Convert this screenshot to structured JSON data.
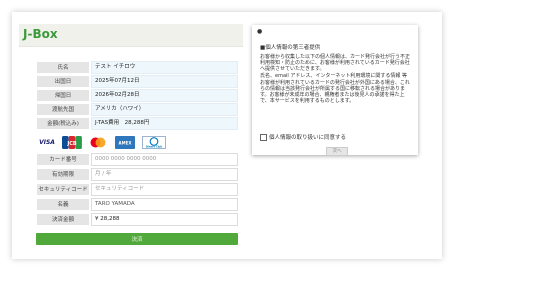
{
  "header": {
    "logo": "J-Box"
  },
  "form": {
    "rows": [
      {
        "label": "氏名",
        "value": "テスト イチロウ"
      },
      {
        "label": "出国日",
        "value": "2025年07月12日"
      },
      {
        "label": "帰国日",
        "value": "2026年02月28日"
      },
      {
        "label": "渡航先国",
        "value": "アメリカ（ハワイ）"
      },
      {
        "label": "金額(税込み)",
        "value": "J-TAS費用　28,288円"
      }
    ],
    "card_brands": [
      "VISA",
      "JCB",
      "MasterCard",
      "AMEX",
      "Diners Club"
    ],
    "card_number": {
      "label": "カード番号",
      "placeholder": "0000 0000 0000 0000"
    },
    "expiry": {
      "label": "有効期限",
      "placeholder": "月 / 年"
    },
    "security": {
      "label": "セキュリティコード",
      "placeholder": "セキュリティコード"
    },
    "name": {
      "label": "名義",
      "value": "TARO YAMADA"
    },
    "amount": {
      "label": "決済金額",
      "value": "¥ 28,288"
    },
    "submit_label": "決済"
  },
  "notice": {
    "mark": "●",
    "title": "■個人情報の第三者提供",
    "paragraphs": [
      "お客様から収集した以下の個人情報は、カード発行会社が行う不正利用検知・防止のために、お客様が利用されているカード発行会社へ提供させていただきます。",
      "氏名、email アドレス、インターネット利用環境に関する情報 等",
      "お客様が利用されているカードの発行会社が外国にある場合、これらの情報は当該発行会社が所属する国に移転される場合があります。お客様が未成年の場合、親権者または後見人の承諾を得た上で、本サービスを利用するものとします。"
    ],
    "agree_label": "個人情報の取り扱いに同意する",
    "ok_label": "次へ"
  }
}
